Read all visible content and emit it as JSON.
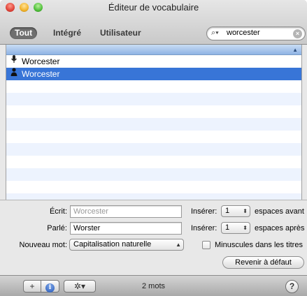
{
  "window": {
    "title": "Éditeur de vocabulaire"
  },
  "scopes": [
    "Tout",
    "Intégré",
    "Utilisateur"
  ],
  "search": {
    "value": "worcester",
    "icon": "magnifier-dropdown-icon"
  },
  "list": {
    "rows": [
      {
        "icon": "microphone-icon",
        "text": "Worcester",
        "selected": false
      },
      {
        "icon": "user-icon",
        "text": "Worcester",
        "selected": true
      }
    ]
  },
  "form": {
    "ecrit_label": "Écrit:",
    "ecrit_value": "Worcester",
    "parle_label": "Parlé:",
    "parle_value": "Worster",
    "nouveau_mot_label": "Nouveau mot:",
    "nouveau_mot_value": "Capitalisation naturelle",
    "inserer_label_1": "Insérer:",
    "inserer_value_1": "1",
    "espaces_avant": "espaces avant",
    "inserer_label_2": "Insérer:",
    "inserer_value_2": "1",
    "espaces_apres": "espaces après",
    "minuscules_label": "Minuscules dans les titres",
    "revenir_label": "Revenir à défaut"
  },
  "bottom_bar": {
    "add_label": "+",
    "info_label": "i",
    "gear_label": "✲▾",
    "word_count": "2 mots",
    "help_label": "?"
  }
}
